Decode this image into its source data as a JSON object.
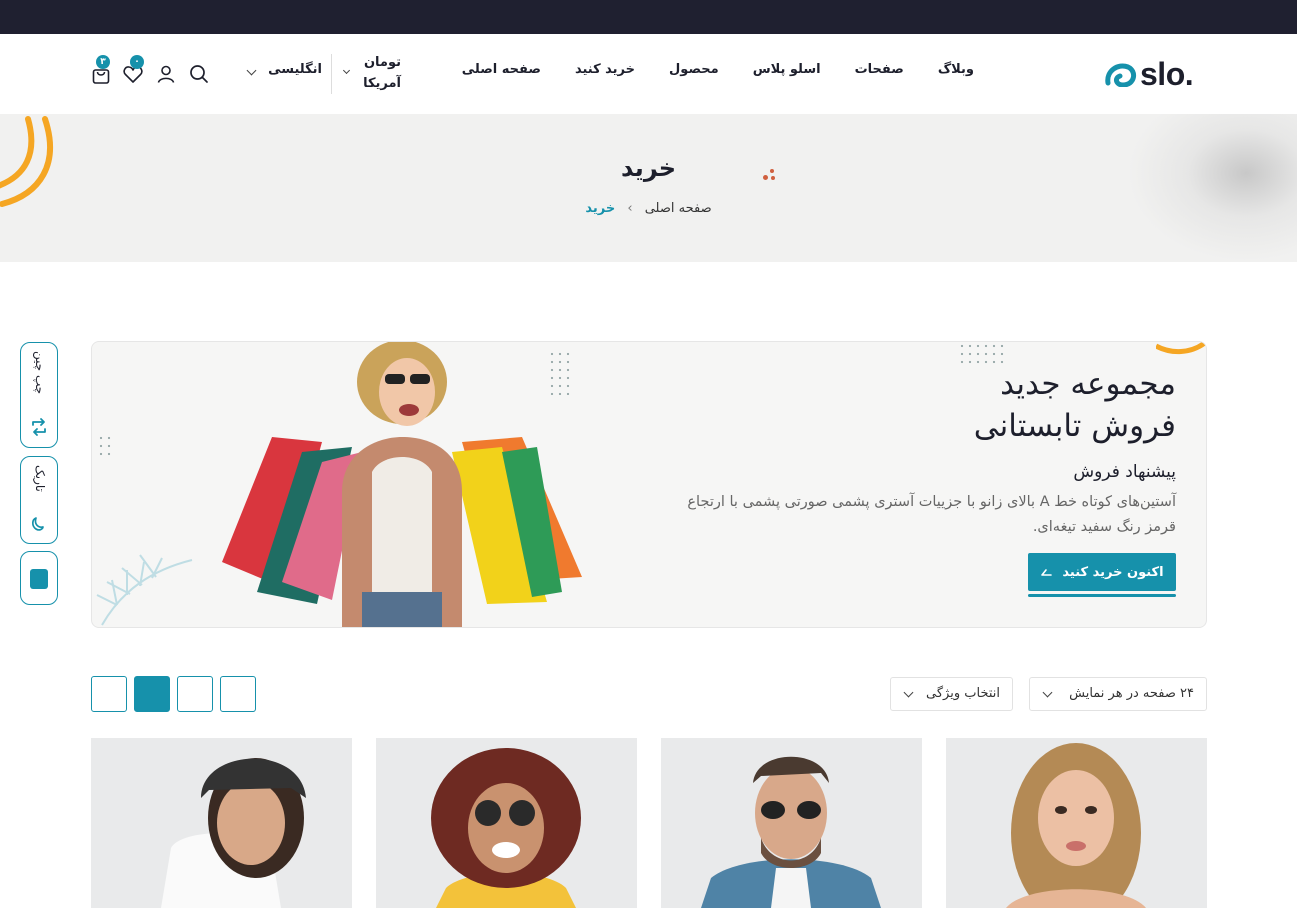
{
  "brand": {
    "name": "slo.",
    "accent": "#1691ab",
    "dark": "#1d1f2c"
  },
  "nav": {
    "items": [
      {
        "label": "صفحه اصلی"
      },
      {
        "label": "خرید کنید"
      },
      {
        "label": "محصول"
      },
      {
        "label": "اسلو پلاس"
      },
      {
        "label": "صفحات"
      },
      {
        "label": "وبلاگ"
      }
    ]
  },
  "header": {
    "currency_line1": "تومان",
    "currency_line2": "آمریکا",
    "language": "انگلیسی",
    "wishlist_count": "۰",
    "cart_count": "۳"
  },
  "hero": {
    "title": "خرید",
    "breadcrumb_home": "صفحه اصلی",
    "breadcrumb_sep": "›",
    "breadcrumb_current": "خرید"
  },
  "banner": {
    "title_line1": "مجموعه جدید",
    "title_line2": "فروش تابستانی",
    "subtitle": "پیشنهاد فروش",
    "description": "آستین‌های کوتاه خط A بالای زانو با جزییات آستری پشمی صورتی پشمی با ارتجاع قرمز رنگ سفید تیغه‌ای.",
    "button_label": "اکنون خرید کنید"
  },
  "side_tools": {
    "rtl_label": "چپ چین",
    "dark_label": "تاریک"
  },
  "toolbar": {
    "per_page": "۲۴ صفحه در هر نمایش",
    "feature_select": "انتخاب ویژگی"
  }
}
